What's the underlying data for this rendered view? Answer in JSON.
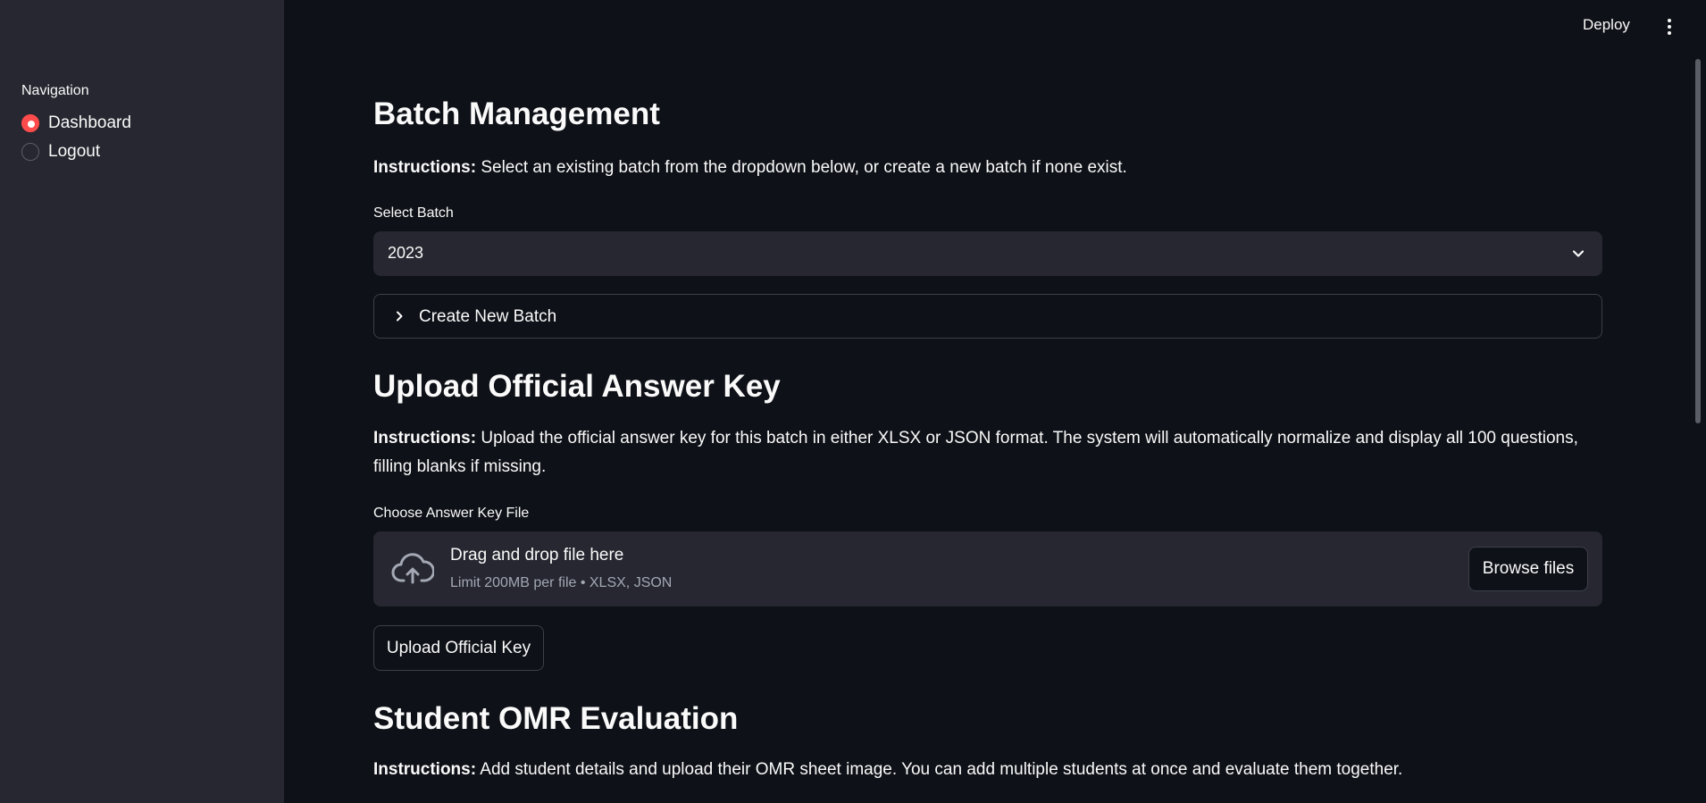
{
  "sidebar": {
    "title": "Navigation",
    "items": [
      {
        "label": "Dashboard",
        "selected": true
      },
      {
        "label": "Logout",
        "selected": false
      }
    ]
  },
  "header": {
    "deploy_label": "Deploy",
    "menu_icon": "kebab-menu-icon"
  },
  "batch": {
    "heading": "Batch Management",
    "instructions_bold": "Instructions:",
    "instructions_text": " Select an existing batch from the dropdown below, or create a new batch if none exist.",
    "select_label": "Select Batch",
    "select_value": "2023",
    "expander_label": "Create New Batch"
  },
  "answer_key": {
    "heading": "Upload Official Answer Key",
    "instructions_bold": "Instructions:",
    "instructions_text": " Upload the official answer key for this batch in either XLSX or JSON format. The system will automatically normalize and display all 100 questions, filling blanks if missing.",
    "file_label": "Choose Answer Key File",
    "dropzone_title": "Drag and drop file here",
    "dropzone_limit": "Limit 200MB per file • XLSX, JSON",
    "browse_label": "Browse files",
    "upload_label": "Upload Official Key"
  },
  "omr": {
    "heading": "Student OMR Evaluation",
    "instructions_bold": "Instructions:",
    "instructions_text": " Add student details and upload their OMR sheet image. You can add multiple students at once and evaluate them together."
  },
  "colors": {
    "background": "#0e1117",
    "sidebar": "#262730",
    "accent": "#ff4b4b",
    "widget": "#262730"
  }
}
